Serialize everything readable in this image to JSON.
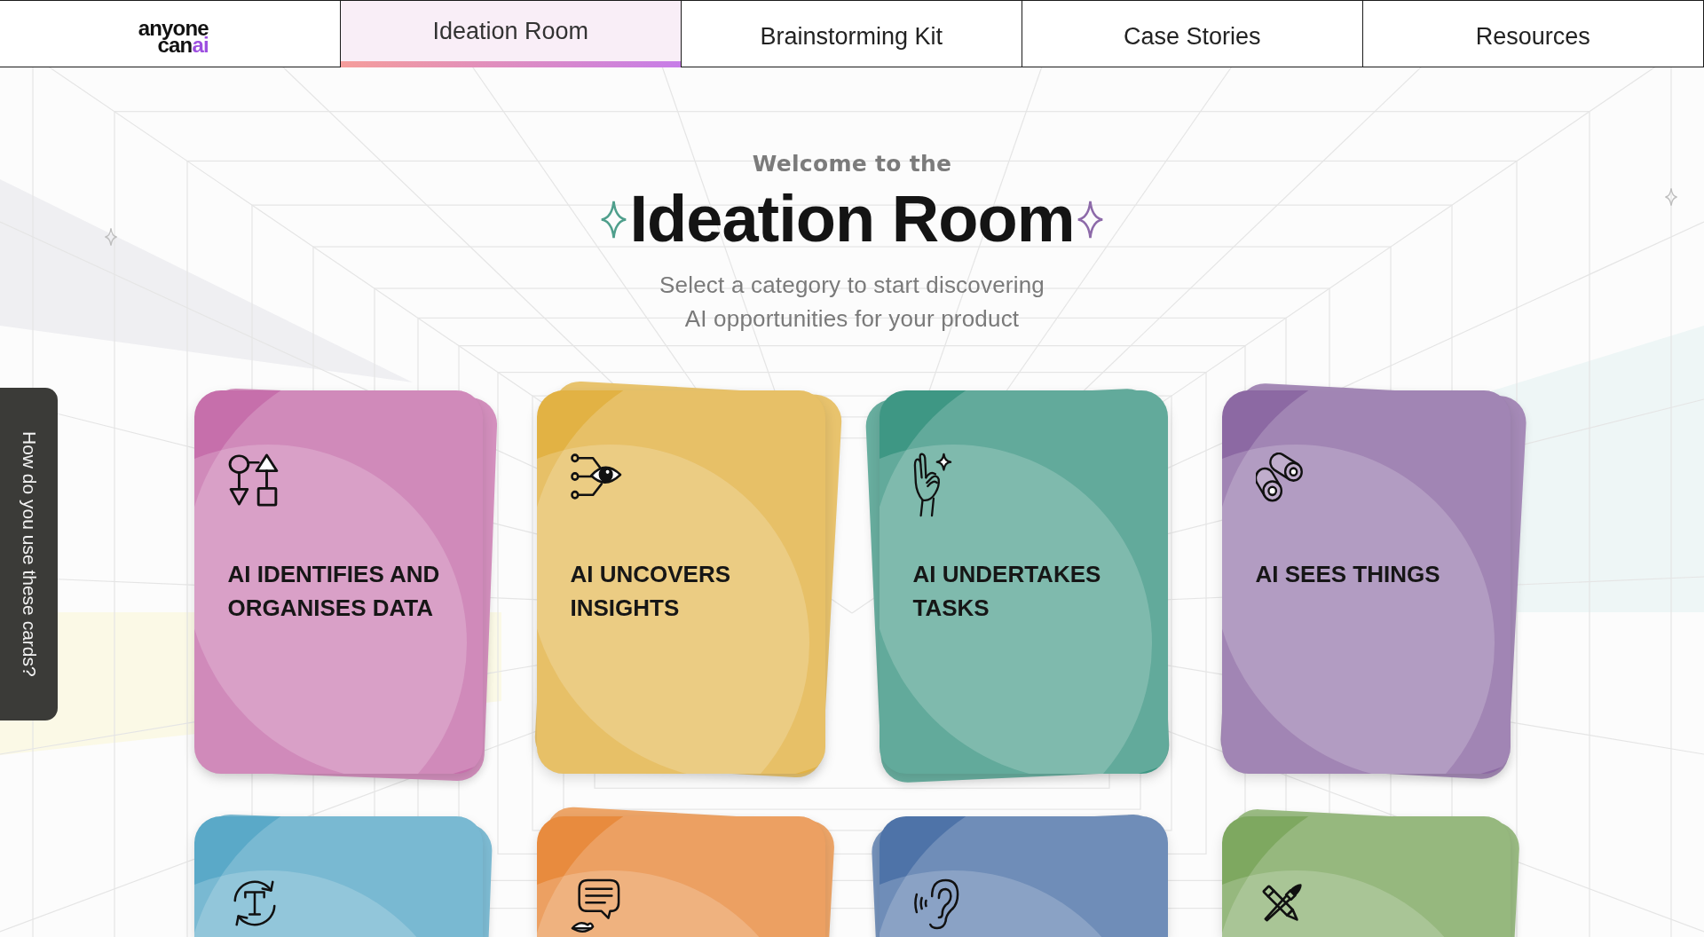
{
  "nav": {
    "logo": {
      "line_1": "anyone",
      "line_2": "can",
      "line_2_accent": "ai"
    },
    "tabs": [
      {
        "label": "Ideation Room",
        "selected": true
      },
      {
        "label": "Brainstorming Kit",
        "selected": false
      },
      {
        "label": "Case Stories",
        "selected": false
      },
      {
        "label": "Resources",
        "selected": false
      }
    ]
  },
  "hero": {
    "kicker": "Welcome to the",
    "title": "Ideation Room",
    "subtitle": "Select a category to start discovering AI opportunities for your product"
  },
  "help_tab": {
    "label": "How do you use these cards?"
  },
  "cards": [
    {
      "kind": "data",
      "title": "AI IDENTIFIES AND ORGANISES DATA",
      "color": "#c66fab"
    },
    {
      "kind": "insights",
      "title": "AI UNCOVERS INSIGHTS",
      "color": "#e2b244"
    },
    {
      "kind": "tasks",
      "title": "AI UNDERTAKES TASKS",
      "color": "#3e9784"
    },
    {
      "kind": "vision",
      "title": "AI SEES THINGS",
      "color": "#8c69a3"
    },
    {
      "kind": "text",
      "color": "#5aa9c8"
    },
    {
      "kind": "speech",
      "color": "#e88b3e"
    },
    {
      "kind": "sound",
      "color": "#4e73a8"
    },
    {
      "kind": "create",
      "color": "#7ea860"
    }
  ]
}
